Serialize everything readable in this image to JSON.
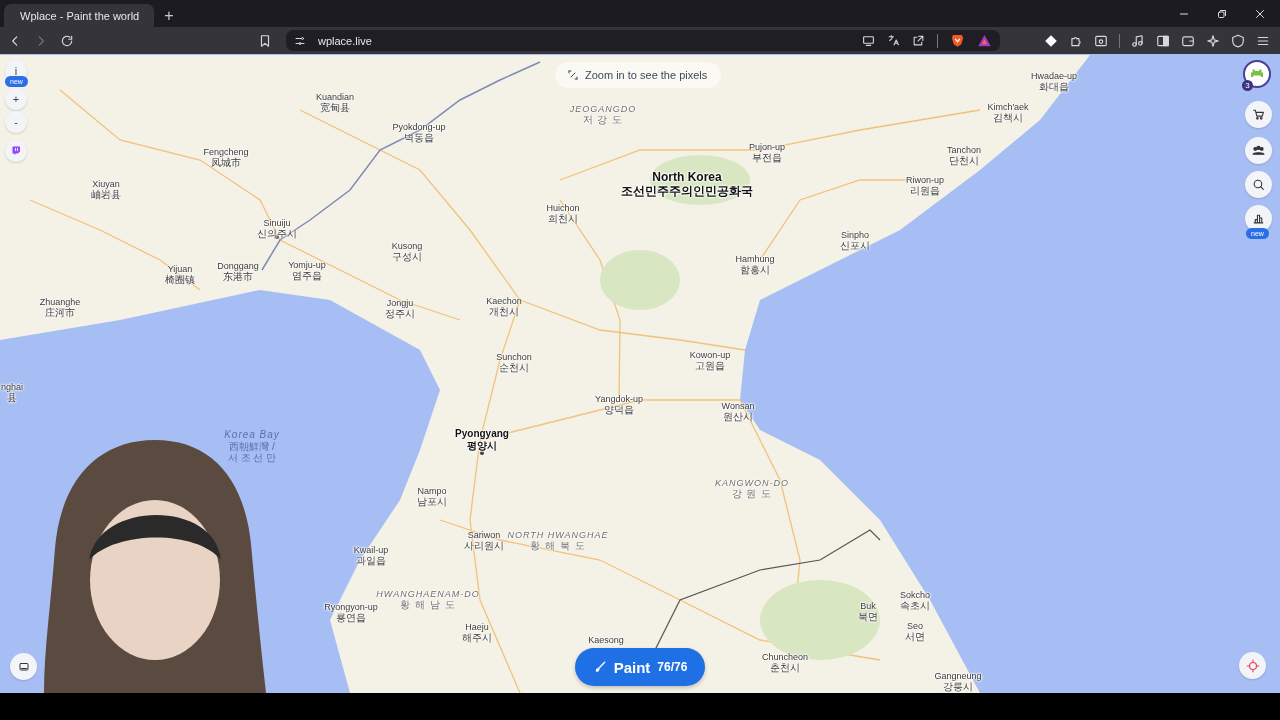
{
  "browser": {
    "tabs": [
      {
        "title": "Wplace - Paint the world",
        "selected": true
      }
    ],
    "new_tab": "+",
    "url": "wplace.live"
  },
  "map": {
    "hint": "Zoom in to see the pixels",
    "labels": [
      {
        "name": "Kuandian",
        "local": "宽甸县",
        "kind": "city"
      },
      {
        "name": "Pyokdong-up",
        "local": "벽동읍",
        "kind": "city"
      },
      {
        "name": "JEOGANGDO",
        "local": "저 강 도",
        "kind": "region"
      },
      {
        "name": "Fengcheng",
        "local": "凤城市",
        "kind": "city"
      },
      {
        "name": "Pujon-up",
        "local": "부전읍",
        "kind": "city"
      },
      {
        "name": "Hwadae-up",
        "local": "화대읍",
        "kind": "city"
      },
      {
        "name": "Kimch'aek",
        "local": "김책시",
        "kind": "city"
      },
      {
        "name": "Tanchon",
        "local": "단천시",
        "kind": "city"
      },
      {
        "name": "Xiuyan",
        "local": "岫岩县",
        "kind": "city"
      },
      {
        "name": "North Korea",
        "local": "조선민주주의인민공화국",
        "kind": "country"
      },
      {
        "name": "Riwon-up",
        "local": "리원읍",
        "kind": "city"
      },
      {
        "name": "Huichon",
        "local": "희천시",
        "kind": "city"
      },
      {
        "name": "Sinuiju",
        "local": "신의주시",
        "kind": "city"
      },
      {
        "name": "Sinpho",
        "local": "신포시",
        "kind": "city"
      },
      {
        "name": "Kusong",
        "local": "구성시",
        "kind": "city"
      },
      {
        "name": "Hamhung",
        "local": "함흥시",
        "kind": "city"
      },
      {
        "name": "Yijuan",
        "local": "椅圈镇",
        "kind": "city"
      },
      {
        "name": "Donggang",
        "local": "东港市",
        "kind": "city"
      },
      {
        "name": "Yomju-up",
        "local": "염주읍",
        "kind": "city"
      },
      {
        "name": "Zhuanghe",
        "local": "庄河市",
        "kind": "city"
      },
      {
        "name": "Jongju",
        "local": "정주시",
        "kind": "city"
      },
      {
        "name": "Kaechon",
        "local": "개천시",
        "kind": "city"
      },
      {
        "name": "Sunchon",
        "local": "순천시",
        "kind": "city"
      },
      {
        "name": "Kowon-up",
        "local": "고원읍",
        "kind": "city"
      },
      {
        "name": "nghai",
        "local": "县",
        "kind": "city"
      },
      {
        "name": "Yangdok-up",
        "local": "양덕읍",
        "kind": "city"
      },
      {
        "name": "Wonsan",
        "local": "원산시",
        "kind": "city"
      },
      {
        "name": "Korea Bay",
        "local": "西朝鮮灣 /",
        "local_2": "서 조 선 만",
        "kind": "sea"
      },
      {
        "name": "Pyongyang",
        "local": "평양시",
        "kind": "capital"
      },
      {
        "name": "KANGWON-DO",
        "local": "강 원 도",
        "kind": "region"
      },
      {
        "name": "Nampo",
        "local": "남포시",
        "kind": "city"
      },
      {
        "name": "Sariwon",
        "local": "사리원시",
        "kind": "city"
      },
      {
        "name": "NORTH HWANGHAE",
        "local": "황 해 북 도",
        "kind": "region"
      },
      {
        "name": "Kwail-up",
        "local": "과일읍",
        "kind": "city"
      },
      {
        "name": "HWANGHAENAM-DO",
        "local": "황 해 남 도",
        "kind": "region"
      },
      {
        "name": "Ryongyon-up",
        "local": "룡연읍",
        "kind": "city"
      },
      {
        "name": "Haeju",
        "local": "해주시",
        "kind": "city"
      },
      {
        "name": "Sokcho",
        "local": "속초시",
        "kind": "city"
      },
      {
        "name": "Buk",
        "local": "북면",
        "kind": "city"
      },
      {
        "name": "Kaesong",
        "kind": "city"
      },
      {
        "name": "Seo",
        "local": "서면",
        "kind": "city"
      },
      {
        "name": "Chuncheon",
        "local": "춘천시",
        "kind": "city"
      },
      {
        "name": "Gangneung",
        "local": "강릉시",
        "kind": "city"
      }
    ]
  },
  "left_controls": {
    "info": {
      "label": "i",
      "badge": "new"
    },
    "zoom_in": "+",
    "zoom_out": "-"
  },
  "right_controls": {
    "profile_badge": "3",
    "leaderboard_badge": "new"
  },
  "paint_button": {
    "label": "Paint",
    "count": "76/76"
  }
}
